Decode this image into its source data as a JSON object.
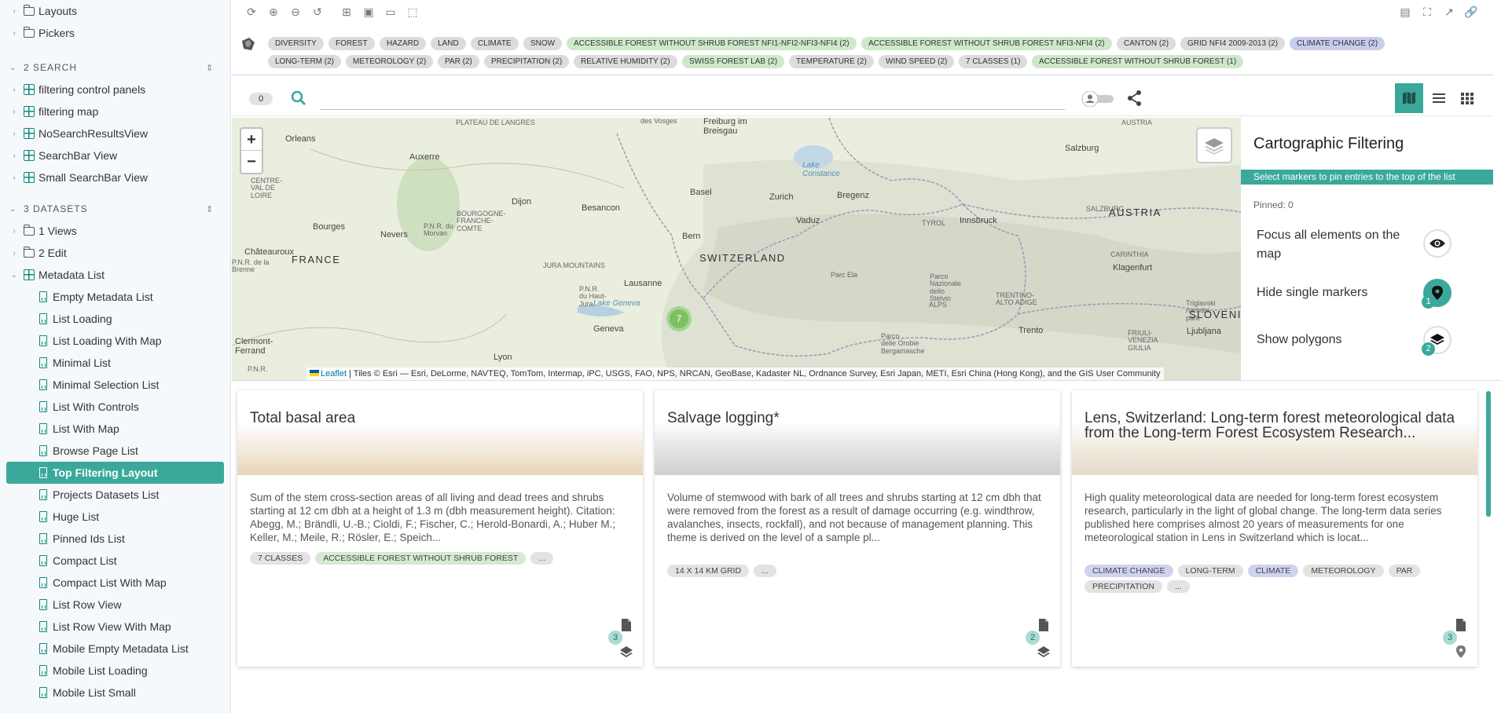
{
  "sidebar": {
    "top_items": [
      {
        "label": "Layouts"
      },
      {
        "label": "Pickers"
      }
    ],
    "search_section": {
      "title": "2 SEARCH",
      "items": [
        "filtering control panels",
        "filtering map",
        "NoSearchResultsView",
        "SearchBar View",
        "Small SearchBar View"
      ]
    },
    "datasets_section": {
      "title": "3 DATASETS",
      "folders": [
        "1 Views",
        "2 Edit"
      ],
      "metadata_list": "Metadata List",
      "stories": [
        "Empty Metadata List",
        "List Loading",
        "List Loading With Map",
        "Minimal List",
        "Minimal Selection List",
        "List With Controls",
        "List With Map",
        "Browse Page List",
        "Top Filtering Layout",
        "Projects Datasets List",
        "Huge List",
        "Pinned Ids List",
        "Compact List",
        "Compact List With Map",
        "List Row View",
        "List Row View With Map",
        "Mobile Empty Metadata List",
        "Mobile List Loading",
        "Mobile List Small"
      ],
      "active_story": "Top Filtering Layout"
    }
  },
  "tags": [
    {
      "label": "DIVERSITY",
      "color": "grey"
    },
    {
      "label": "FOREST",
      "color": "grey"
    },
    {
      "label": "HAZARD",
      "color": "grey"
    },
    {
      "label": "LAND",
      "color": "grey"
    },
    {
      "label": "CLIMATE",
      "color": "grey"
    },
    {
      "label": "SNOW",
      "color": "grey"
    },
    {
      "label": "ACCESSIBLE FOREST WITHOUT SHRUB FOREST NFI1-NFI2-NFI3-NFI4 (2)",
      "color": "green"
    },
    {
      "label": "ACCESSIBLE FOREST WITHOUT SHRUB FOREST NFI3-NFI4 (2)",
      "color": "green"
    },
    {
      "label": "CANTON (2)",
      "color": "grey"
    },
    {
      "label": "GRID NFI4 2009-2013 (2)",
      "color": "grey"
    },
    {
      "label": "CLIMATE CHANGE (2)",
      "color": "purple"
    },
    {
      "label": "LONG-TERM (2)",
      "color": "grey"
    },
    {
      "label": "METEOROLOGY (2)",
      "color": "grey"
    },
    {
      "label": "PAR (2)",
      "color": "grey"
    },
    {
      "label": "PRECIPITATION (2)",
      "color": "grey"
    },
    {
      "label": "RELATIVE HUMIDITY (2)",
      "color": "grey"
    },
    {
      "label": "SWISS FOREST LAB (2)",
      "color": "green"
    },
    {
      "label": "TEMPERATURE (2)",
      "color": "grey"
    },
    {
      "label": "WIND SPEED (2)",
      "color": "grey"
    },
    {
      "label": "7 CLASSES (1)",
      "color": "grey"
    },
    {
      "label": "ACCESSIBLE FOREST WITHOUT SHRUB FOREST (1)",
      "color": "green"
    }
  ],
  "search": {
    "result_count": "0",
    "placeholder": "",
    "value": ""
  },
  "map": {
    "zoom_in": "+",
    "zoom_out": "−",
    "cluster_count": "7",
    "attribution_link": "Leaflet",
    "attribution_text": " | Tiles © Esri — Esri, DeLorme, NAVTEQ, TomTom, Intermap, iPC, USGS, FAO, NPS, NRCAN, GeoBase, Kadaster NL, Ordnance Survey, Esri Japan, METI, Esri China (Hong Kong), and the GIS User Community",
    "labels": {
      "plateau": "PLATEAU DE LANGRES",
      "vosges": "des Vosges",
      "freiburg": "Freiburg im\nBreisgau",
      "austria_small": "AUSTRIA",
      "orleans": "Orleans",
      "auxerre": "Auxerre",
      "lake_constance": "Lake\nConstance",
      "salzburg": "Salzburg",
      "basel": "Basel",
      "zurich": "Zurich",
      "bregenz": "Bregenz",
      "centre": "CENTRE-\nVAL DE\nLOIRE",
      "dijon": "Dijon",
      "bourgogne": "BOURGOGNE-\nFRANCHE-\nCOMTE",
      "besancon": "Besancon",
      "vaduz": "Vaduz",
      "tirol": "TYROL",
      "innsbruck": "Innsbruck",
      "salzburg_region": "SALZBURG",
      "austria": "AUSTRIA",
      "bourges": "Bourges",
      "nevers": "Nevers",
      "morvan": "P.N.R. du\nMorvan",
      "bern": "Bern",
      "chateauroux": "Châteauroux",
      "brenne": "P.N.R. de la\nBrenne",
      "france": "FRANCE",
      "switzerland": "SWITZERLAND",
      "carinthia": "CARINTHIA",
      "klagenfurt": "Klagenfurt",
      "jura": "JURA MOUNTAINS",
      "lausanne": "Lausanne",
      "haut_jura": "P.N.R.\ndu Haut-\nJura",
      "lake_geneva": "Lake Geneva",
      "parc_ela": "Parc Ela",
      "stelvio": "Parco\nNazionale\ndello\nStelvio",
      "alps": "ALPS",
      "trentino": "TRENTINO-\nALTO ADIGE",
      "triglav": "Triglavski\nnarodni\npark",
      "slovenia": "SLOVENIA",
      "geneva": "Geneva",
      "clermont": "Clermont-\nFerrand",
      "lyon": "Lyon",
      "trento": "Trento",
      "friuli": "FRIULI-\nVENEZIA\nGIULIA",
      "ljubljana": "Ljubljana",
      "bergamasche": "Parco\ndelle Orobie\nBergamasche",
      "pnr_small": "P.N.R."
    }
  },
  "carto": {
    "title": "Cartographic Filtering",
    "hint": "Select markers to pin entries to the top of the list",
    "pinned": "Pinned: 0",
    "options": [
      {
        "label": "Focus all elements on the map",
        "icon": "eye-icon"
      },
      {
        "label": "Hide single markers",
        "icon": "pin-icon",
        "badge": "1"
      },
      {
        "label": "Show polygons",
        "icon": "layers-icon",
        "badge": "2"
      }
    ]
  },
  "cards": [
    {
      "title": "Total basal area",
      "description": "Sum of the stem cross-section areas of all living and dead trees and shrubs starting at 12 cm dbh at a height of 1.3 m (dbh measurement height). Citation: Abegg, M.; Brändli, U.-B.; Cioldi, F.; Fischer, C.; Herold-Bonardi, A.; Huber M.; Keller, M.; Meile, R.; Rösler, E.; Speich...",
      "tags": [
        {
          "label": "7 CLASSES",
          "color": "grey"
        },
        {
          "label": "ACCESSIBLE FOREST WITHOUT SHRUB FOREST",
          "color": "green"
        },
        {
          "label": "...",
          "color": "grey"
        }
      ],
      "badge": "3"
    },
    {
      "title": "Salvage logging*",
      "description": "Volume of stemwood with bark of all trees and shrubs starting at 12 cm dbh that were removed from the forest as a result of damage occurring (e.g. windthrow, avalanches, insects, rockfall), and not because of management planning. This theme is derived on the level of a sample pl...",
      "tags": [
        {
          "label": "14 X 14 KM GRID",
          "color": "grey"
        },
        {
          "label": "...",
          "color": "grey"
        }
      ],
      "badge": "2"
    },
    {
      "title": "Lens, Switzerland: Long-term forest meteorological data from the Long-term Forest Ecosystem Research...",
      "description": "High quality meteorological data are needed for long-term forest ecosystem research, particularly in the light of global change. The long-term data series published here comprises almost 20 years of measurements for one meteorological station in Lens in Switzerland which is locat...",
      "tags": [
        {
          "label": "CLIMATE CHANGE",
          "color": "purple"
        },
        {
          "label": "LONG-TERM",
          "color": "grey"
        },
        {
          "label": "CLIMATE",
          "color": "purple"
        },
        {
          "label": "METEOROLOGY",
          "color": "grey"
        },
        {
          "label": "PAR",
          "color": "grey"
        },
        {
          "label": "PRECIPITATION",
          "color": "grey"
        },
        {
          "label": "...",
          "color": "grey"
        }
      ],
      "badge": "3"
    }
  ],
  "colors": {
    "accent": "#3aa99b",
    "tag_grey": "#dcdcdc",
    "tag_green": "#cfe8cc",
    "tag_purple": "#c8cdee"
  }
}
